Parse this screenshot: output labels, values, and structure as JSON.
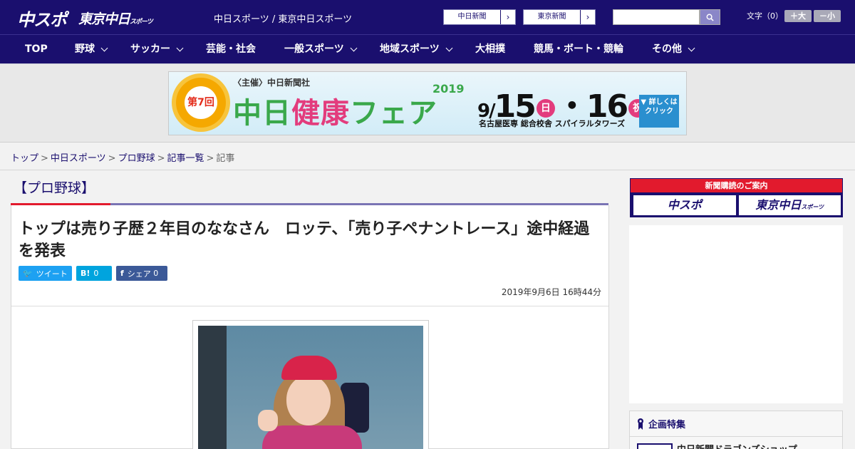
{
  "header": {
    "logo_chuspo": "中スポ",
    "logo_tokyo": "東京中日",
    "logo_tokyo_small": "スポーツ",
    "site_names": "中日スポーツ / 東京中日スポーツ",
    "paper_buttons": [
      {
        "label": "中日新聞"
      },
      {
        "label": "東京新聞"
      }
    ],
    "search_placeholder": "",
    "font_size_label": "文字（0）",
    "font_larger": "＋大",
    "font_smaller": "－小"
  },
  "nav": {
    "items": [
      {
        "label": "TOP"
      },
      {
        "label": "野球"
      },
      {
        "label": "サッカー"
      },
      {
        "label": "芸能・社会"
      },
      {
        "label": "一般スポーツ"
      },
      {
        "label": "地域スポーツ"
      },
      {
        "label": "大相撲"
      },
      {
        "label": "競馬・ボート・競輪"
      },
      {
        "label": "その他"
      }
    ]
  },
  "banner": {
    "badge": "第7回",
    "host": "〈主催〉中日新聞社",
    "title_a": "中日",
    "title_b": "健康",
    "title_c": "フェア",
    "year": "2019",
    "date_prefix": "9/",
    "date_day1": "15",
    "day1_badge": "日",
    "date_sep": "・",
    "date_day2": "16",
    "day2_badge": "祝",
    "venue": "名古屋医専 総合校舎 スパイラルタワーズ",
    "detail_button": "▼ 詳しくは クリック"
  },
  "breadcrumb": {
    "items": [
      {
        "label": "トップ"
      },
      {
        "label": "中日スポーツ"
      },
      {
        "label": "プロ野球"
      },
      {
        "label": "記事一覧"
      }
    ],
    "current": "記事",
    "separator": ">"
  },
  "article": {
    "category": "【プロ野球】",
    "headline": "トップは売り子歴２年目のななさん　ロッテ、「売り子ペナントレース」途中経過を発表",
    "share": {
      "tweet_icon": "🐦",
      "tweet_label": "ツイート",
      "hatena_icon": "B!",
      "hatena_count": "0",
      "fb_icon": "f",
      "fb_label": "シェア",
      "fb_count": "0"
    },
    "published": "2019年9月6日 16時44分"
  },
  "sidebar": {
    "subscribe_title": "新聞購読のご案内",
    "subscribe_chuspo": "中スポ",
    "subscribe_tokyo": "東京中日",
    "subscribe_tokyo_small": "スポーツ",
    "feature_title": "企画特集",
    "feature_item": "中日新聞ドラゴンズショップ"
  },
  "colors": {
    "brand_navy": "#1a0f6e",
    "accent_red": "#e21a2d",
    "twitter_blue": "#1da1f2",
    "hatena_blue": "#00a4de",
    "facebook_blue": "#3b5998"
  }
}
